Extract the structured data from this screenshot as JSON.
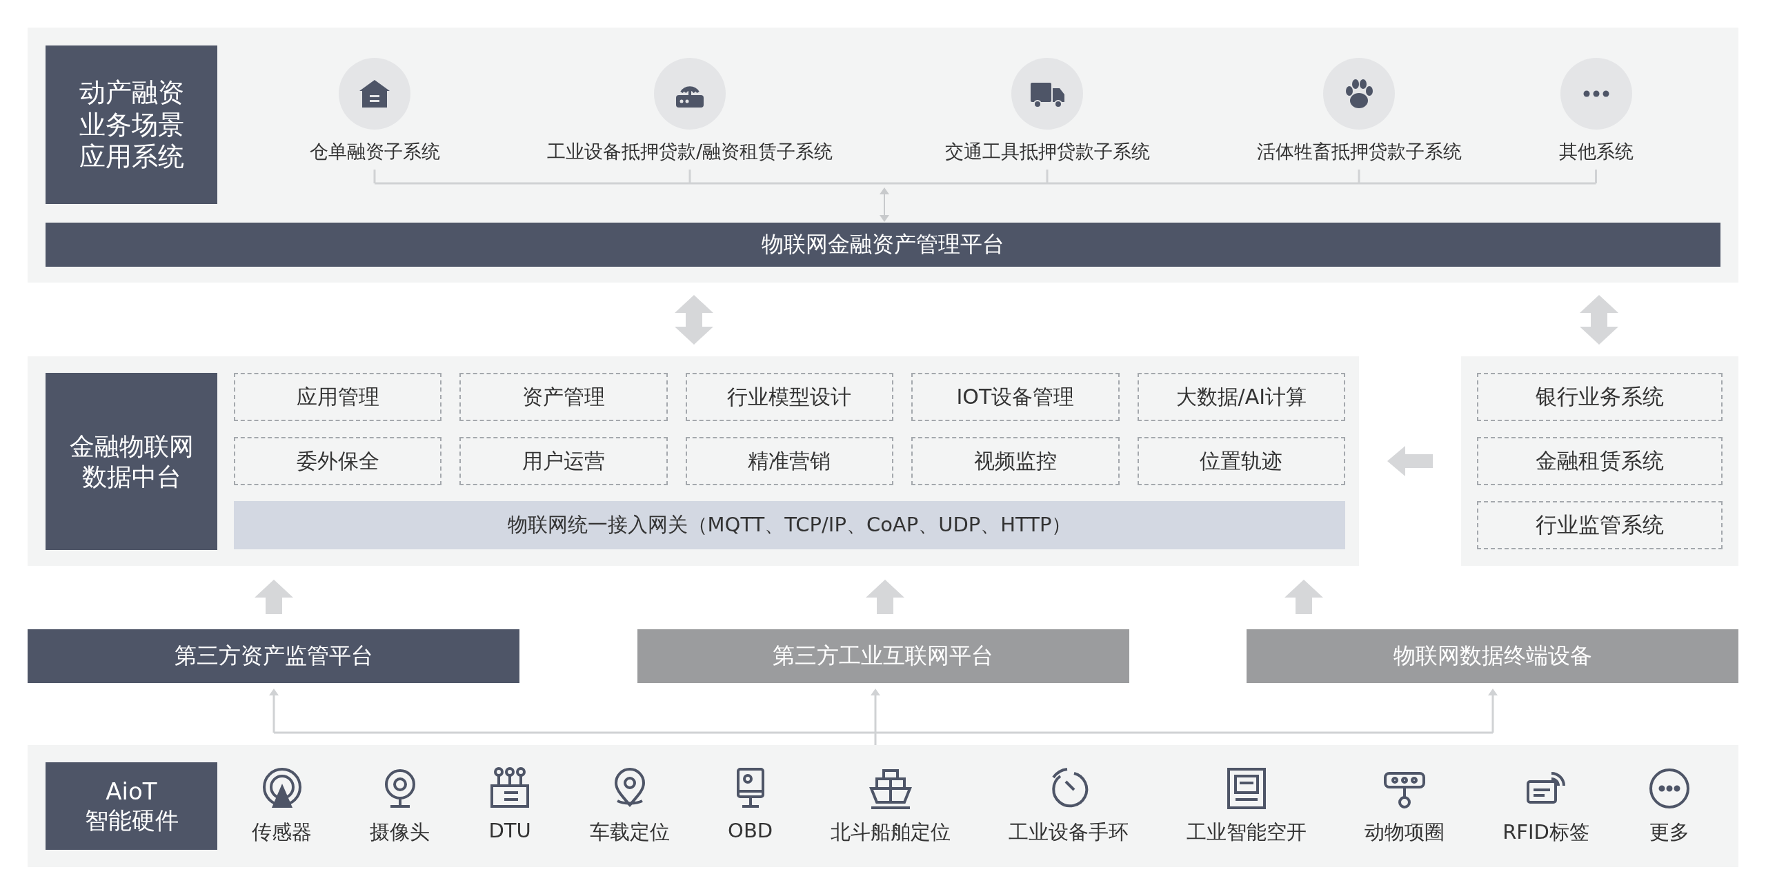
{
  "application_layer": {
    "title": "动产融资业务场景应用系统",
    "systems": [
      {
        "label": "仓单融资子系统",
        "kind": "warehouse"
      },
      {
        "label": "工业设备抵押贷款/融资租赁子系统",
        "kind": "router"
      },
      {
        "label": "交通工具抵押贷款子系统",
        "kind": "truck"
      },
      {
        "label": "活体牲畜抵押贷款子系统",
        "kind": "paw"
      },
      {
        "label": "其他系统",
        "kind": "more"
      }
    ],
    "platform": "物联网金融资产管理平台"
  },
  "data_platform": {
    "title": "金融物联网数据中台",
    "modules": [
      "应用管理",
      "资产管理",
      "行业模型设计",
      "IOT设备管理",
      "大数据/AI计算",
      "委外保全",
      "用户运营",
      "精准营销",
      "视频监控",
      "位置轨迹"
    ],
    "gateway": "物联网统一接入网关（MQTT、TCP/IP、CoAP、UDP、HTTP）"
  },
  "external_systems": [
    "银行业务系统",
    "金融租赁系统",
    "行业监管系统"
  ],
  "source_platforms": [
    {
      "label": "第三方资产监管平台",
      "kind": "dark"
    },
    {
      "label": "第三方工业互联网平台",
      "kind": "gray"
    },
    {
      "label": "物联网数据终端设备",
      "kind": "gray"
    }
  ],
  "hardware": {
    "title_lines": [
      "AioT",
      "智能硬件"
    ],
    "devices": [
      {
        "label": "传感器",
        "kind": "sensor"
      },
      {
        "label": "摄像头",
        "kind": "camera"
      },
      {
        "label": "DTU",
        "kind": "dtu"
      },
      {
        "label": "车载定位",
        "kind": "pin"
      },
      {
        "label": "OBD",
        "kind": "obd"
      },
      {
        "label": "北斗船舶定位",
        "kind": "ship"
      },
      {
        "label": "工业设备手环",
        "kind": "band"
      },
      {
        "label": "工业智能空开",
        "kind": "breaker"
      },
      {
        "label": "动物项圈",
        "kind": "collar"
      },
      {
        "label": "RFID标签",
        "kind": "tag"
      },
      {
        "label": "更多",
        "kind": "more"
      }
    ]
  }
}
